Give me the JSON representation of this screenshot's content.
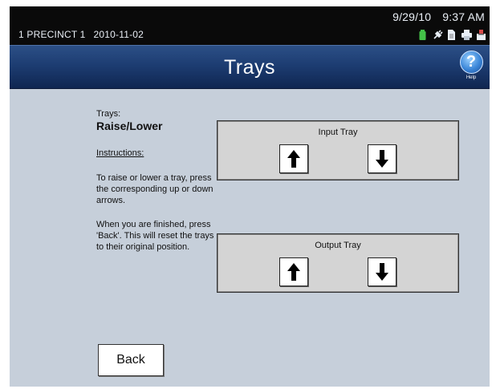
{
  "status_bar": {
    "precinct": "1 PRECINCT 1",
    "election_date": "2010-11-02",
    "date": "9/29/10",
    "time": "9:37 AM",
    "icons": [
      "battery-icon",
      "power-plug-icon",
      "document-icon",
      "printer-icon",
      "ballot-box-icon"
    ]
  },
  "header": {
    "title": "Trays",
    "help_label": "Help",
    "help_glyph": "?"
  },
  "left_panel": {
    "trays_label": "Trays:",
    "subtitle": "Raise/Lower",
    "instructions_label": "Instructions:",
    "paragraph1": "To raise or lower a tray, press the corresponding up or down arrows.",
    "paragraph2": "When you are finished, press 'Back'. This will reset the trays to their original position."
  },
  "trays": {
    "input_title": "Input Tray",
    "output_title": "Output Tray"
  },
  "footer": {
    "back_label": "Back"
  },
  "colors": {
    "title_bar": "#1d3d72",
    "content_bg": "#c6cfda",
    "tray_bg": "#d4d4d4"
  }
}
